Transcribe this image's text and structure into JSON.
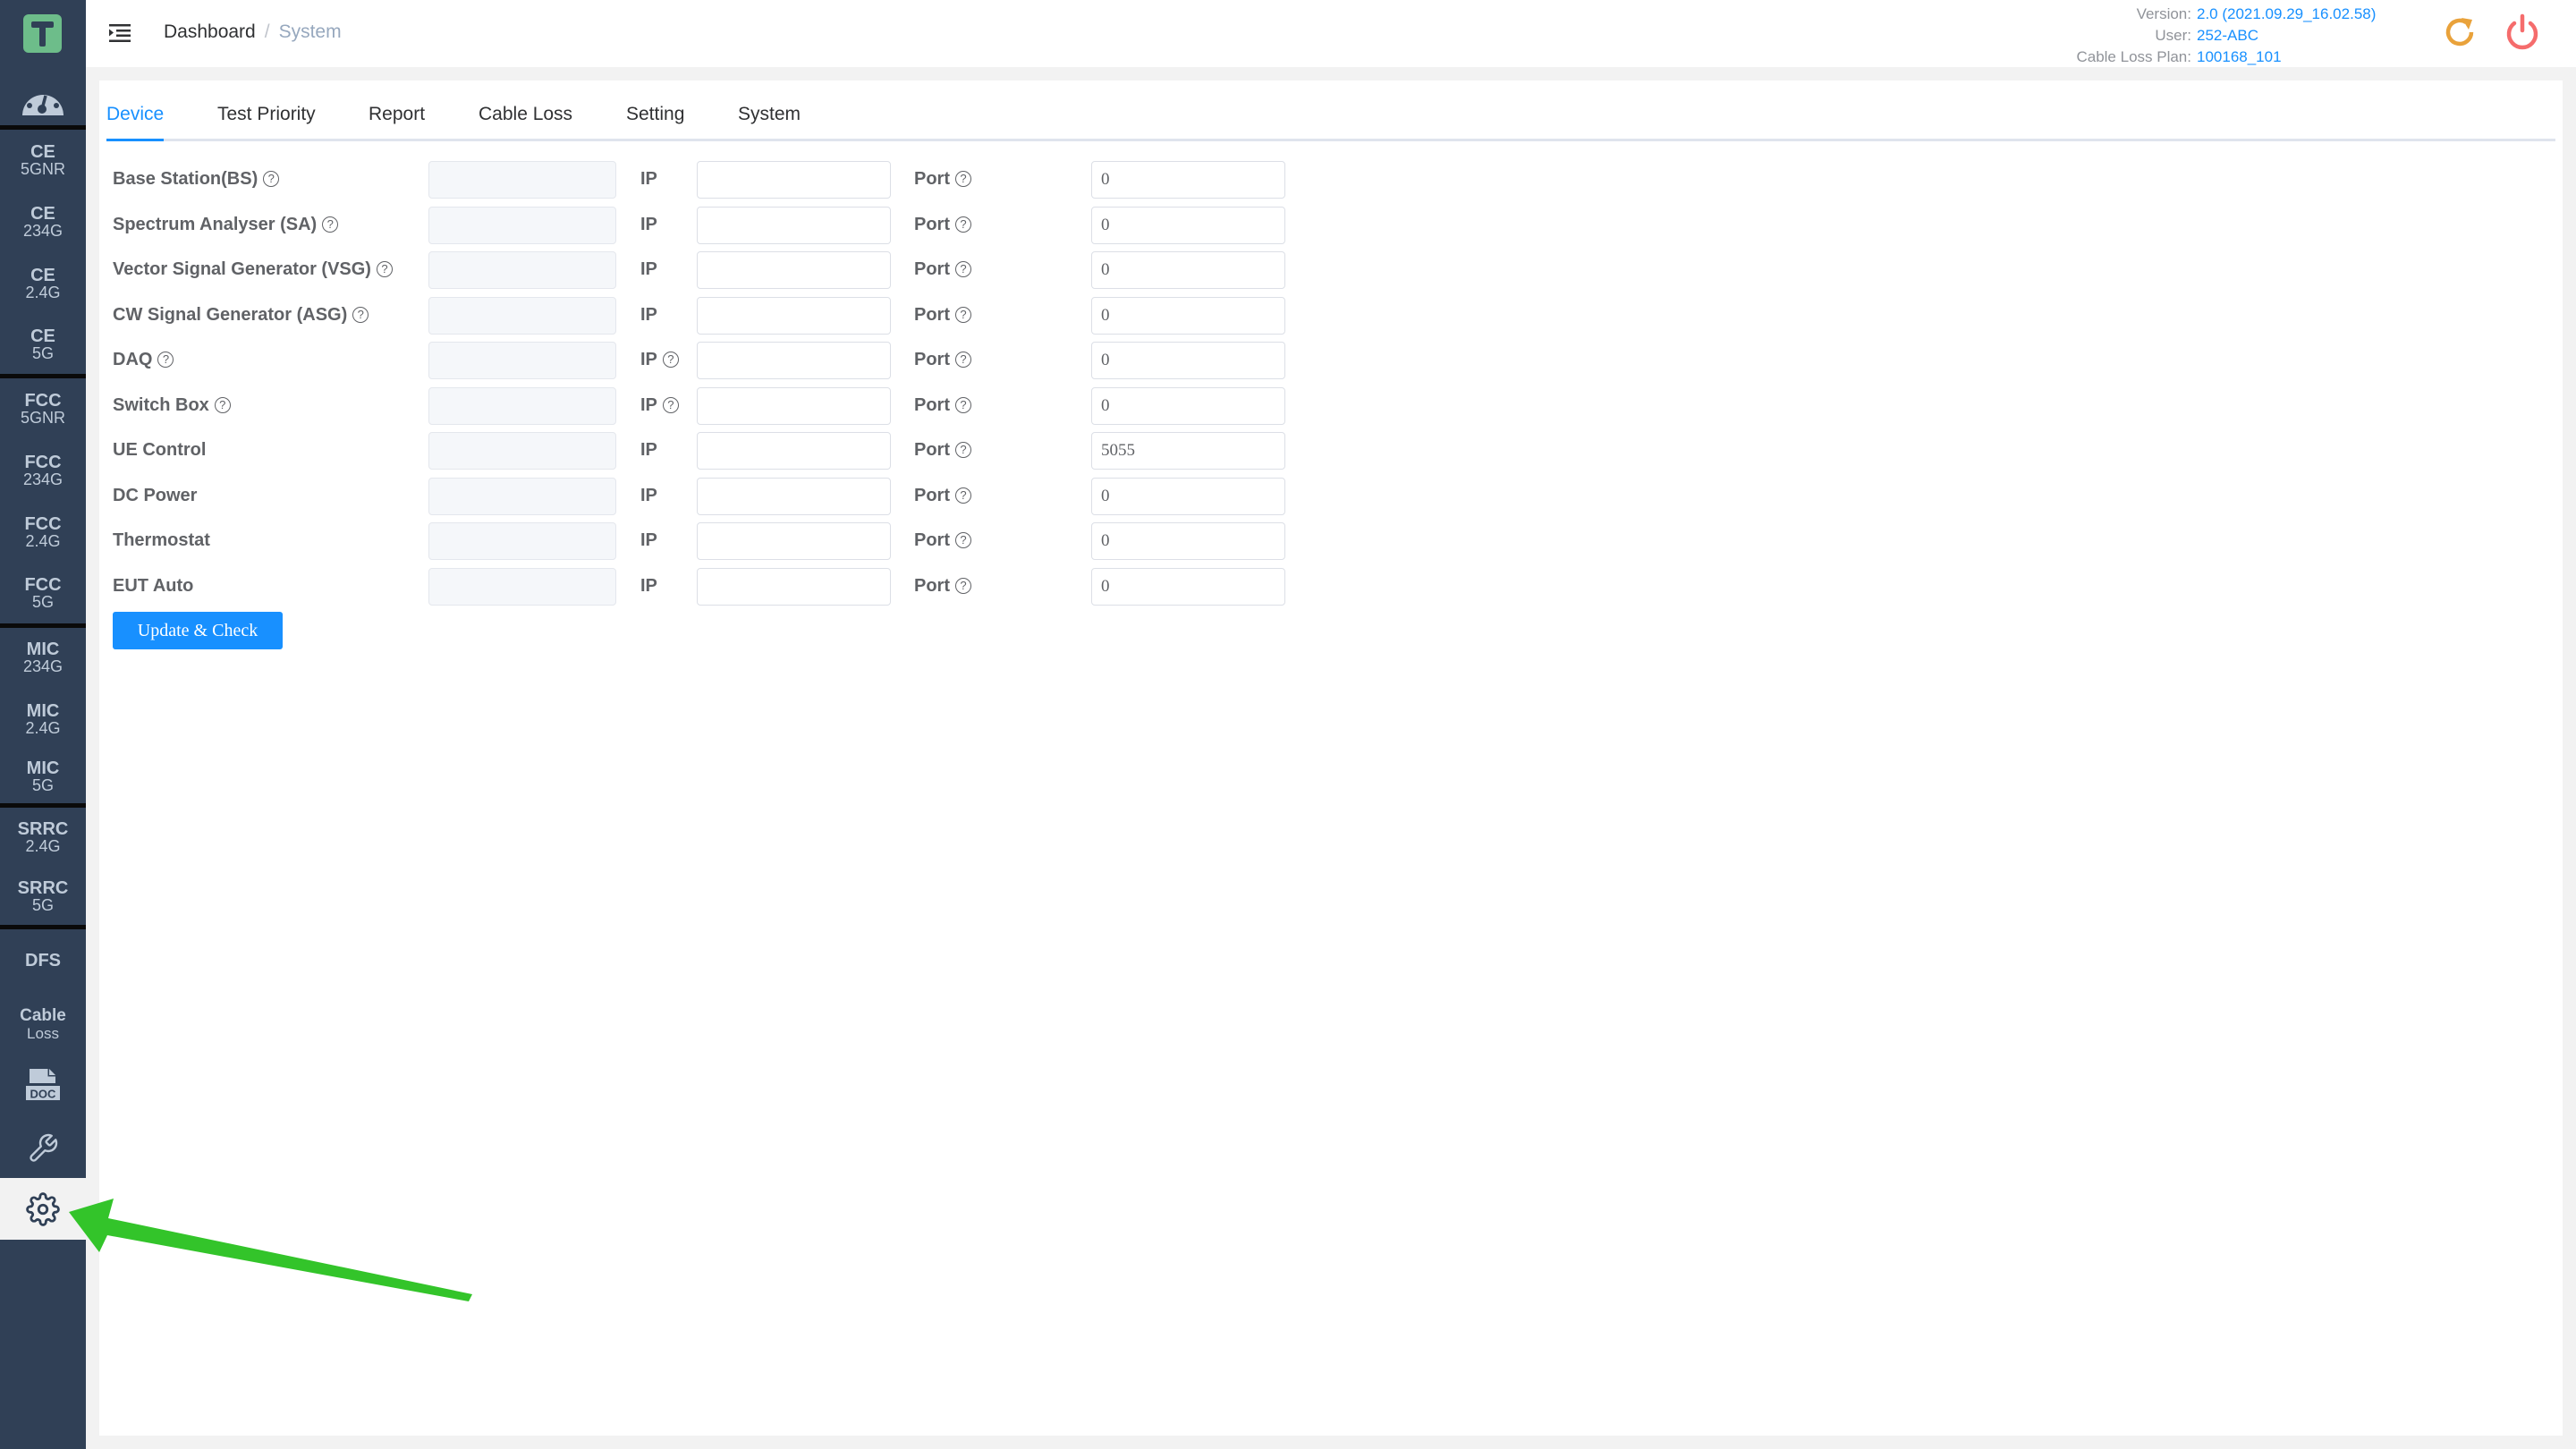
{
  "sidebar": {
    "items": [
      {
        "l1": "CE",
        "l2": "5GNR"
      },
      {
        "l1": "CE",
        "l2": "234G"
      },
      {
        "l1": "CE",
        "l2": "2.4G"
      },
      {
        "l1": "CE",
        "l2": "5G"
      },
      {
        "l1": "FCC",
        "l2": "5GNR"
      },
      {
        "l1": "FCC",
        "l2": "234G"
      },
      {
        "l1": "FCC",
        "l2": "2.4G"
      },
      {
        "l1": "FCC",
        "l2": "5G"
      },
      {
        "l1": "MIC",
        "l2": "234G"
      },
      {
        "l1": "MIC",
        "l2": "2.4G"
      },
      {
        "l1": "MIC",
        "l2": "5G"
      },
      {
        "l1": "SRRC",
        "l2": "2.4G"
      },
      {
        "l1": "SRRC",
        "l2": "5G"
      },
      {
        "l1": "DFS",
        "l2": ""
      },
      {
        "l1": "Cable",
        "l2": "Loss"
      }
    ],
    "doc_icon_text": "DOC",
    "active": "settings"
  },
  "header": {
    "breadcrumb": [
      "Dashboard",
      "System"
    ],
    "breadcrumb_sep": "/",
    "info": [
      {
        "key": "Version:",
        "value": "2.0 (2021.09.29_16.02.58)"
      },
      {
        "key": "User:",
        "value": "252-ABC"
      },
      {
        "key": "Cable Loss Plan:",
        "value": "100168_101"
      }
    ]
  },
  "tabs": [
    "Device",
    "Test Priority",
    "Report",
    "Cable Loss",
    "Setting",
    "System"
  ],
  "active_tab": "Device",
  "form": {
    "ip_label": "IP",
    "port_label": "Port",
    "rows": [
      {
        "label": "Base Station(BS)",
        "help": true,
        "ip_help": false,
        "name": "",
        "ip": "",
        "port": "0"
      },
      {
        "label": "Spectrum Analyser (SA)",
        "help": true,
        "ip_help": false,
        "name": "",
        "ip": "",
        "port": "0"
      },
      {
        "label": "Vector Signal Generator (VSG)",
        "help": true,
        "ip_help": false,
        "name": "",
        "ip": "",
        "port": "0"
      },
      {
        "label": "CW Signal Generator (ASG)",
        "help": true,
        "ip_help": false,
        "name": "",
        "ip": "",
        "port": "0"
      },
      {
        "label": "DAQ",
        "help": true,
        "ip_help": true,
        "name": "",
        "ip": "",
        "port": "0"
      },
      {
        "label": "Switch Box",
        "help": true,
        "ip_help": true,
        "name": "",
        "ip": "",
        "port": "0"
      },
      {
        "label": "UE Control",
        "help": false,
        "ip_help": false,
        "name": "",
        "ip": "",
        "port": "5055"
      },
      {
        "label": "DC Power",
        "help": false,
        "ip_help": false,
        "name": "",
        "ip": "",
        "port": "0"
      },
      {
        "label": "Thermostat",
        "help": false,
        "ip_help": false,
        "name": "",
        "ip": "",
        "port": "0"
      },
      {
        "label": "EUT Auto",
        "help": false,
        "ip_help": false,
        "name": "",
        "ip": "",
        "port": "0"
      }
    ],
    "submit_label": "Update & Check"
  },
  "annotation": {
    "type": "arrow",
    "color": "#33c42a",
    "points_to": "settings-gear"
  }
}
